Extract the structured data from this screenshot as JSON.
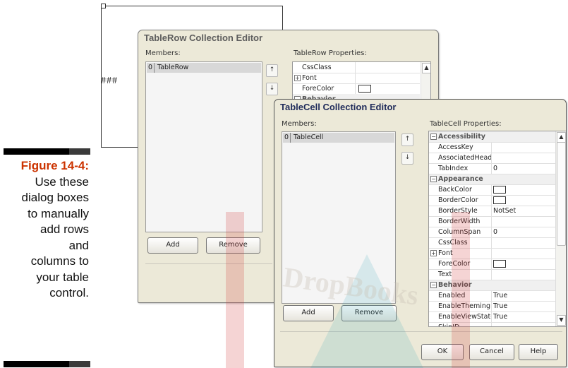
{
  "caption": {
    "figure": "Figure 14-4:",
    "lines": [
      "Use these",
      "dialog boxes",
      "to manually",
      "add rows",
      "and",
      "columns to",
      "your table",
      "control."
    ]
  },
  "page": {
    "placeholder": "###"
  },
  "row_editor": {
    "title": "TableRow Collection Editor",
    "members_label": "Members:",
    "member": {
      "index": "0",
      "name": "TableRow"
    },
    "props_label": "TableRow Properties:",
    "props": [
      {
        "name": "CssClass",
        "value": ""
      },
      {
        "name": "Font",
        "value": ""
      },
      {
        "name": "ForeColor",
        "value": ""
      },
      {
        "name": "Behavior",
        "value": ""
      }
    ],
    "add_label": "Add",
    "remove_label": "Remove"
  },
  "cell_editor": {
    "title": "TableCell Collection Editor",
    "members_label": "Members:",
    "member": {
      "index": "0",
      "name": "TableCell"
    },
    "props_label": "TableCell Properties:",
    "rows": [
      {
        "kind": "cat",
        "name": "Accessibility"
      },
      {
        "kind": "prop",
        "name": "AccessKey",
        "value": ""
      },
      {
        "kind": "prop",
        "name": "AssociatedHeaderCellID",
        "value": ""
      },
      {
        "kind": "prop",
        "name": "TabIndex",
        "value": "0"
      },
      {
        "kind": "cat",
        "name": "Appearance"
      },
      {
        "kind": "prop",
        "name": "BackColor",
        "value": "",
        "swatch": true
      },
      {
        "kind": "prop",
        "name": "BorderColor",
        "value": "",
        "swatch": true
      },
      {
        "kind": "prop",
        "name": "BorderStyle",
        "value": "NotSet"
      },
      {
        "kind": "prop",
        "name": "BorderWidth",
        "value": ""
      },
      {
        "kind": "prop",
        "name": "ColumnSpan",
        "value": "0"
      },
      {
        "kind": "prop",
        "name": "CssClass",
        "value": ""
      },
      {
        "kind": "expand",
        "name": "Font",
        "value": ""
      },
      {
        "kind": "prop",
        "name": "ForeColor",
        "value": "",
        "swatch": true
      },
      {
        "kind": "prop",
        "name": "Text",
        "value": ""
      },
      {
        "kind": "cat",
        "name": "Behavior"
      },
      {
        "kind": "prop",
        "name": "Enabled",
        "value": "True"
      },
      {
        "kind": "prop",
        "name": "EnableTheming",
        "value": "True"
      },
      {
        "kind": "prop",
        "name": "EnableViewState",
        "value": "True"
      },
      {
        "kind": "prop",
        "name": "SkinID",
        "value": ""
      }
    ],
    "add_label": "Add",
    "remove_label": "Remove",
    "ok_label": "OK",
    "cancel_label": "Cancel",
    "help_label": "Help"
  },
  "watermark": {
    "text": "DropBooks"
  }
}
